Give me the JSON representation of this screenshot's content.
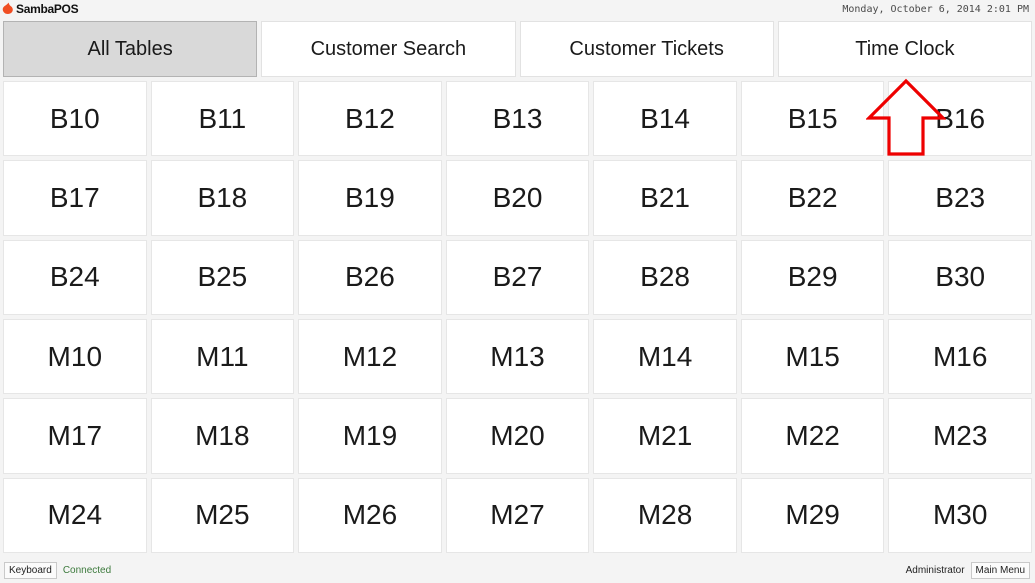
{
  "app": {
    "brand_name": "SambaPOS",
    "brand_icon": "flame-icon",
    "brand_color": "#f04e23",
    "clock": "Monday, October 6, 2014 2:01 PM"
  },
  "tabs": [
    {
      "label": "All Tables",
      "active": true
    },
    {
      "label": "Customer Search",
      "active": false
    },
    {
      "label": "Customer Tickets",
      "active": false
    },
    {
      "label": "Time Clock",
      "active": false
    }
  ],
  "tables": [
    "B10",
    "B11",
    "B12",
    "B13",
    "B14",
    "B15",
    "B16",
    "B17",
    "B18",
    "B19",
    "B20",
    "B21",
    "B22",
    "B23",
    "B24",
    "B25",
    "B26",
    "B27",
    "B28",
    "B29",
    "B30",
    "M10",
    "M11",
    "M12",
    "M13",
    "M14",
    "M15",
    "M16",
    "M17",
    "M18",
    "M19",
    "M20",
    "M21",
    "M22",
    "M23",
    "M24",
    "M25",
    "M26",
    "M27",
    "M28",
    "M29",
    "M30"
  ],
  "grid": {
    "columns": 7,
    "rows": 6
  },
  "annotation": {
    "type": "arrow-up",
    "color": "#ee0000",
    "points_to": "Time Clock"
  },
  "statusbar": {
    "keyboard_label": "Keyboard",
    "connection_status": "Connected",
    "connection_color": "#3d7a3d",
    "user": "Administrator",
    "main_menu_label": "Main Menu"
  }
}
